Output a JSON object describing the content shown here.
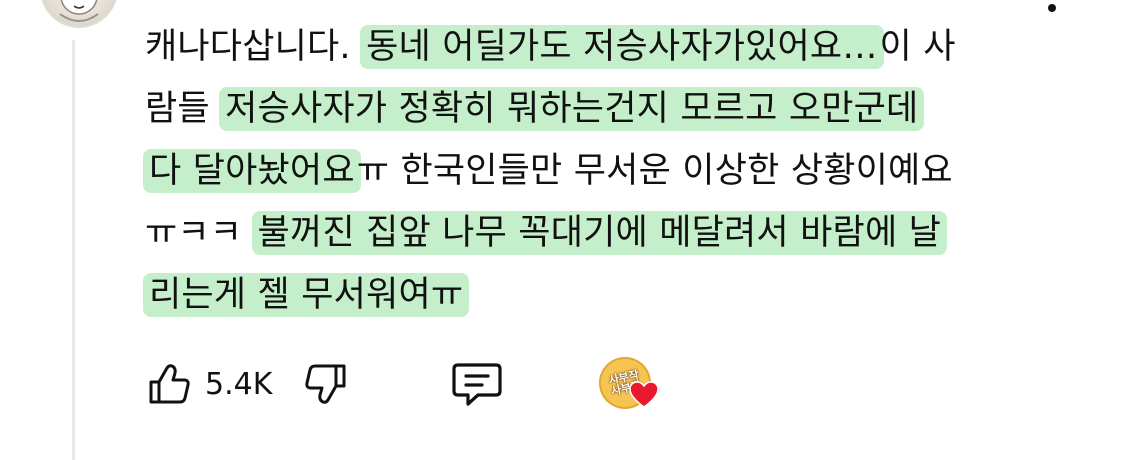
{
  "comment": {
    "lines": [
      {
        "plain": "캐나다삽니다. ",
        "highlight": "동네 어딜가도 저승사자가있어요…",
        "tail": "이 사"
      },
      {
        "plain": "람들 ",
        "highlight": "저승사자가 정확히 뭐하는건지 모르고 오만군데",
        "tail": ""
      },
      {
        "plain": "",
        "highlight": "다 달아놨어요",
        "tail": "ㅠ 한국인들만 무서운 이상한 상황이예요"
      },
      {
        "plain": "ㅠㅋㅋ ",
        "highlight": "불꺼진 집앞 나무 꼭대기에 메달려서 바람에 날",
        "tail": ""
      },
      {
        "plain": "",
        "highlight": "리는게 젤 무서워여ㅠ",
        "tail": ""
      }
    ],
    "highlight_color": "#96e1a0"
  },
  "actions": {
    "like_icon": "thumbs-up-icon",
    "like_count": "5.4K",
    "dislike_icon": "thumbs-down-icon",
    "reply_icon": "comment-icon",
    "creator_heart_icon": "creator-heart-icon"
  },
  "creator_badge": {
    "line1": "사부작",
    "line2": "사부작"
  },
  "menu_icon": "more-options-icon",
  "avatar_icon": "user-avatar-icon",
  "colors": {
    "text": "#111111",
    "thread_line": "#e7e7e7",
    "heart": "#e8192c",
    "badge": "#f5c453"
  }
}
